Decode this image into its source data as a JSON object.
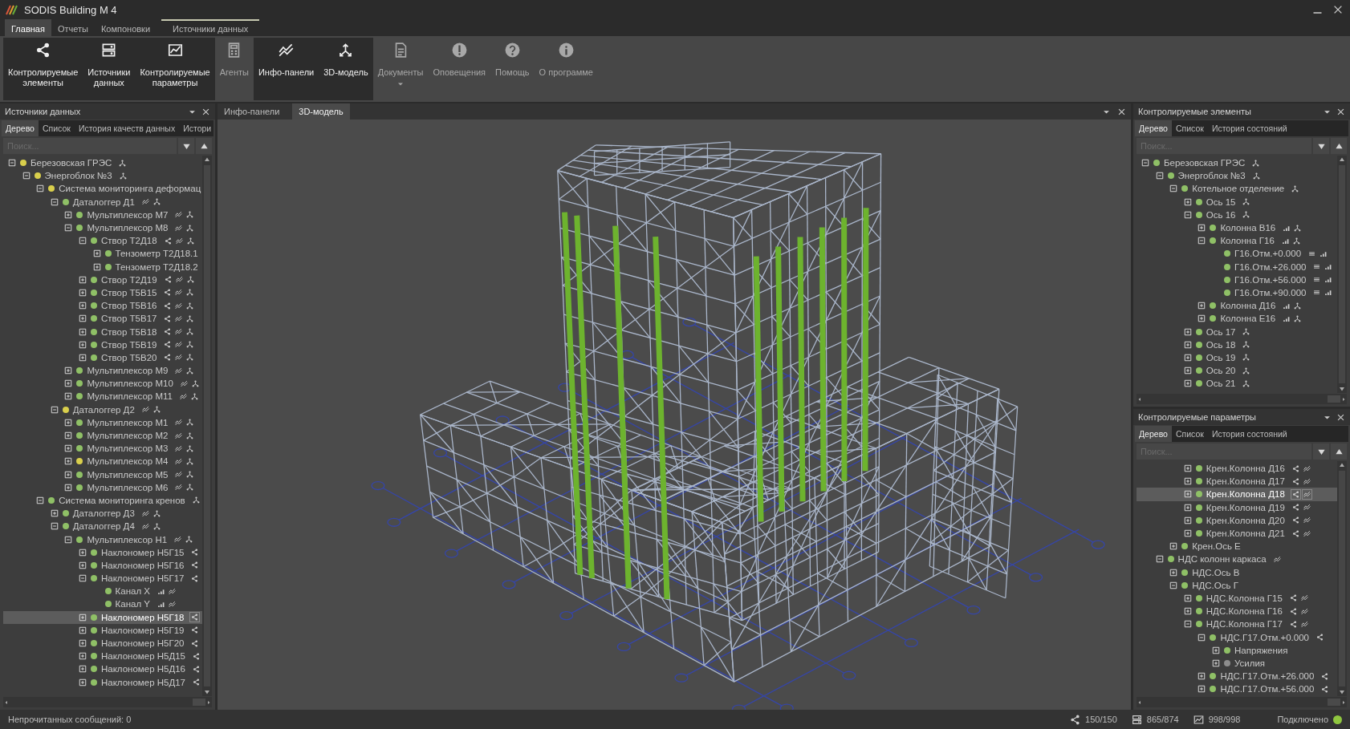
{
  "window": {
    "title": "SODIS Building M 4"
  },
  "ribbon_tabs": [
    {
      "label": "Главная",
      "selected": true,
      "contextual": false
    },
    {
      "label": "Отчеты",
      "selected": false,
      "contextual": false
    },
    {
      "label": "Компоновки",
      "selected": false,
      "contextual": false
    },
    {
      "label": "Источники данных",
      "selected": false,
      "contextual": true
    }
  ],
  "ribbon_buttons": [
    {
      "kind": "share",
      "label": "Контролируемые\nэлементы",
      "selected": true
    },
    {
      "kind": "sources",
      "label": "Источники\nданных",
      "selected": true
    },
    {
      "kind": "chart",
      "label": "Контролируемые\nпараметры",
      "selected": true
    },
    {
      "kind": "calculator",
      "label": "Агенты",
      "selected": false
    },
    {
      "kind": "trend",
      "label": "Инфо-панели",
      "selected": true
    },
    {
      "kind": "model",
      "label": "3D-модель",
      "selected": true
    },
    {
      "kind": "document",
      "label": "Документы",
      "selected": false,
      "dropdown": true
    },
    {
      "kind": "alert",
      "label": "Оповещения",
      "selected": false
    },
    {
      "kind": "help",
      "label": "Помощь",
      "selected": false
    },
    {
      "kind": "info",
      "label": "О программе",
      "selected": false
    }
  ],
  "left_panel": {
    "title": "Источники данных",
    "tabs": [
      {
        "label": "Дерево",
        "selected": true
      },
      {
        "label": "Список",
        "selected": false
      },
      {
        "label": "История качеств данных",
        "selected": false
      },
      {
        "label": "Истори",
        "selected": false
      }
    ],
    "search": {
      "placeholder": "Поиск..."
    },
    "tree": [
      {
        "label": "Березовская ГРЭС",
        "color": "#d9cf4c",
        "expanded": true,
        "selected": false,
        "hierarchy": true,
        "children": [
          {
            "label": "Энергоблок №3",
            "color": "#d9cf4c",
            "expanded": true,
            "selected": false,
            "hierarchy": true,
            "children": [
              {
                "label": "Система мониторинга деформац",
                "color": "#d9cf4c",
                "expanded": true,
                "selected": false,
                "children": [
                  {
                    "label": "Даталоггер Д1",
                    "color": "#8fc066",
                    "expanded": true,
                    "selected": false,
                    "trend": true,
                    "hierarchy": true,
                    "children": [
                      {
                        "label": "Мультиплексор М7",
                        "color": "#8fc066",
                        "expanded": false,
                        "selected": false,
                        "trend": true,
                        "hierarchy": true
                      },
                      {
                        "label": "Мультиплексор М8",
                        "color": "#8fc066",
                        "expanded": true,
                        "selected": false,
                        "trend": true,
                        "hierarchy": true,
                        "children": [
                          {
                            "label": "Створ Т2Д18",
                            "color": "#8fc066",
                            "expanded": true,
                            "selected": false,
                            "share": true,
                            "trend": true,
                            "hierarchy": true,
                            "children": [
                              {
                                "label": "Тензометр Т2Д18.1",
                                "color": "#8fc066",
                                "expanded": false,
                                "selected": false
                              },
                              {
                                "label": "Тензометр Т2Д18.2",
                                "color": "#8fc066",
                                "expanded": false,
                                "selected": false
                              }
                            ]
                          },
                          {
                            "label": "Створ Т2Д19",
                            "color": "#8fc066",
                            "expanded": false,
                            "selected": false,
                            "share": true,
                            "trend": true,
                            "hierarchy": true
                          },
                          {
                            "label": "Створ Т5В15",
                            "color": "#8fc066",
                            "expanded": false,
                            "selected": false,
                            "share": true,
                            "trend": true,
                            "hierarchy": true
                          },
                          {
                            "label": "Створ Т5В16",
                            "color": "#8fc066",
                            "expanded": false,
                            "selected": false,
                            "share": true,
                            "trend": true,
                            "hierarchy": true
                          },
                          {
                            "label": "Створ Т5В17",
                            "color": "#8fc066",
                            "expanded": false,
                            "selected": false,
                            "share": true,
                            "trend": true,
                            "hierarchy": true
                          },
                          {
                            "label": "Створ Т5В18",
                            "color": "#8fc066",
                            "expanded": false,
                            "selected": false,
                            "share": true,
                            "trend": true,
                            "hierarchy": true
                          },
                          {
                            "label": "Створ Т5В19",
                            "color": "#8fc066",
                            "expanded": false,
                            "selected": false,
                            "share": true,
                            "trend": true,
                            "hierarchy": true
                          },
                          {
                            "label": "Створ Т5В20",
                            "color": "#8fc066",
                            "expanded": false,
                            "selected": false,
                            "share": true,
                            "trend": true,
                            "hierarchy": true
                          }
                        ]
                      },
                      {
                        "label": "Мультиплексор М9",
                        "color": "#8fc066",
                        "expanded": false,
                        "selected": false,
                        "trend": true,
                        "hierarchy": true
                      },
                      {
                        "label": "Мультиплексор М10",
                        "color": "#8fc066",
                        "expanded": false,
                        "selected": false,
                        "trend": true,
                        "hierarchy": true
                      },
                      {
                        "label": "Мультиплексор М11",
                        "color": "#8fc066",
                        "expanded": false,
                        "selected": false,
                        "trend": true,
                        "hierarchy": true
                      }
                    ]
                  },
                  {
                    "label": "Даталоггер Д2",
                    "color": "#d9cf4c",
                    "expanded": true,
                    "selected": false,
                    "trend": true,
                    "hierarchy": true,
                    "children": [
                      {
                        "label": "Мультиплексор М1",
                        "color": "#8fc066",
                        "expanded": false,
                        "selected": false,
                        "trend": true,
                        "hierarchy": true
                      },
                      {
                        "label": "Мультиплексор М2",
                        "color": "#8fc066",
                        "expanded": false,
                        "selected": false,
                        "trend": true,
                        "hierarchy": true
                      },
                      {
                        "label": "Мультиплексор М3",
                        "color": "#8fc066",
                        "expanded": false,
                        "selected": false,
                        "trend": true,
                        "hierarchy": true
                      },
                      {
                        "label": "Мультиплексор М4",
                        "color": "#d9cf4c",
                        "expanded": false,
                        "selected": false,
                        "trend": true,
                        "hierarchy": true
                      },
                      {
                        "label": "Мультиплексор М5",
                        "color": "#8fc066",
                        "expanded": false,
                        "selected": false,
                        "trend": true,
                        "hierarchy": true
                      },
                      {
                        "label": "Мультиплексор М6",
                        "color": "#8fc066",
                        "expanded": false,
                        "selected": false,
                        "trend": true,
                        "hierarchy": true
                      }
                    ]
                  }
                ]
              },
              {
                "label": "Система мониторинга кренов",
                "color": "#8fc066",
                "expanded": true,
                "selected": false,
                "hierarchy": true,
                "children": [
                  {
                    "label": "Даталоггер Д3",
                    "color": "#8fc066",
                    "expanded": false,
                    "selected": false,
                    "trend": true,
                    "hierarchy": true
                  },
                  {
                    "label": "Даталоггер Д4",
                    "color": "#8fc066",
                    "expanded": true,
                    "selected": false,
                    "trend": true,
                    "hierarchy": true,
                    "children": [
                      {
                        "label": "Мультиплексор Н1",
                        "color": "#8fc066",
                        "expanded": true,
                        "selected": false,
                        "trend": true,
                        "hierarchy": true,
                        "children": [
                          {
                            "label": "Наклономер Н5Г15",
                            "color": "#8fc066",
                            "expanded": false,
                            "selected": false,
                            "share": true
                          },
                          {
                            "label": "Наклономер Н5Г16",
                            "color": "#8fc066",
                            "expanded": false,
                            "selected": false,
                            "share": true
                          },
                          {
                            "label": "Наклономер Н5Г17",
                            "color": "#8fc066",
                            "expanded": true,
                            "selected": false,
                            "share": true,
                            "children": [
                              {
                                "label": "Канал X",
                                "color": "#8fc066",
                                "selected": false,
                                "signal": true,
                                "trend": true
                              },
                              {
                                "label": "Канал Y",
                                "color": "#8fc066",
                                "selected": false,
                                "signal": true,
                                "trend": true
                              }
                            ]
                          },
                          {
                            "label": "Наклономер Н5Г18",
                            "color": "#8fc066",
                            "expanded": false,
                            "selected": true,
                            "share": true
                          },
                          {
                            "label": "Наклономер Н5Г19",
                            "color": "#8fc066",
                            "expanded": false,
                            "selected": false,
                            "share": true
                          },
                          {
                            "label": "Наклономер Н5Г20",
                            "color": "#8fc066",
                            "expanded": false,
                            "selected": false,
                            "share": true
                          },
                          {
                            "label": "Наклономер Н5Д15",
                            "color": "#8fc066",
                            "expanded": false,
                            "selected": false,
                            "share": true
                          },
                          {
                            "label": "Наклономер Н5Д16",
                            "color": "#8fc066",
                            "expanded": false,
                            "selected": false,
                            "share": true
                          },
                          {
                            "label": "Наклономер Н5Д17",
                            "color": "#8fc066",
                            "expanded": false,
                            "selected": false,
                            "share": true
                          }
                        ]
                      }
                    ]
                  }
                ]
              }
            ]
          }
        ]
      }
    ]
  },
  "document_tabs": [
    {
      "label": "Инфо-панели",
      "selected": false
    },
    {
      "label": "3D-модель",
      "selected": true
    }
  ],
  "right_top_panel": {
    "title": "Контролируемые элементы",
    "tabs": [
      {
        "label": "Дерево",
        "selected": true
      },
      {
        "label": "Список",
        "selected": false
      },
      {
        "label": "История состояний",
        "selected": false
      }
    ],
    "search": {
      "placeholder": "Поиск..."
    },
    "tree": [
      {
        "label": "Березовская ГРЭС",
        "color": "#8fc066",
        "expanded": true,
        "selected": false,
        "hierarchy": true,
        "children": [
          {
            "label": "Энергоблок №3",
            "color": "#8fc066",
            "expanded": true,
            "selected": false,
            "hierarchy": true,
            "children": [
              {
                "label": "Котельное отделение",
                "color": "#8fc066",
                "expanded": true,
                "selected": false,
                "hierarchy": true,
                "children": [
                  {
                    "label": "Ось 15",
                    "color": "#8fc066",
                    "expanded": false,
                    "selected": false,
                    "hierarchy": true
                  },
                  {
                    "label": "Ось 16",
                    "color": "#8fc066",
                    "expanded": true,
                    "selected": false,
                    "hierarchy": true,
                    "children": [
                      {
                        "label": "Колонна В16",
                        "color": "#8fc066",
                        "expanded": false,
                        "selected": false,
                        "signal": true,
                        "hierarchy": true
                      },
                      {
                        "label": "Колонна Г16",
                        "color": "#8fc066",
                        "expanded": true,
                        "selected": false,
                        "signal": true,
                        "hierarchy": true,
                        "children": [
                          {
                            "label": "Г16.Отм.+0.000",
                            "color": "#8fc066",
                            "selected": false,
                            "list": true,
                            "signal": true
                          },
                          {
                            "label": "Г16.Отм.+26.000",
                            "color": "#8fc066",
                            "selected": false,
                            "list": true,
                            "signal": true
                          },
                          {
                            "label": "Г16.Отм.+56.000",
                            "color": "#8fc066",
                            "selected": false,
                            "list": true,
                            "signal": true
                          },
                          {
                            "label": "Г16.Отм.+90.000",
                            "color": "#8fc066",
                            "selected": false,
                            "list": true,
                            "signal": true
                          }
                        ]
                      },
                      {
                        "label": "Колонна Д16",
                        "color": "#8fc066",
                        "expanded": false,
                        "selected": false,
                        "signal": true,
                        "hierarchy": true
                      },
                      {
                        "label": "Колонна Е16",
                        "color": "#8fc066",
                        "expanded": false,
                        "selected": false,
                        "signal": true,
                        "hierarchy": true
                      }
                    ]
                  },
                  {
                    "label": "Ось 17",
                    "color": "#8fc066",
                    "expanded": false,
                    "selected": false,
                    "hierarchy": true
                  },
                  {
                    "label": "Ось 18",
                    "color": "#8fc066",
                    "expanded": false,
                    "selected": false,
                    "hierarchy": true
                  },
                  {
                    "label": "Ось 19",
                    "color": "#8fc066",
                    "expanded": false,
                    "selected": false,
                    "hierarchy": true
                  },
                  {
                    "label": "Ось 20",
                    "color": "#8fc066",
                    "expanded": false,
                    "selected": false,
                    "hierarchy": true
                  },
                  {
                    "label": "Ось 21",
                    "color": "#8fc066",
                    "expanded": false,
                    "selected": false,
                    "hierarchy": true
                  }
                ]
              }
            ]
          }
        ]
      }
    ]
  },
  "right_bottom_panel": {
    "title": "Контролируемые параметры",
    "tabs": [
      {
        "label": "Дерево",
        "selected": true
      },
      {
        "label": "Список",
        "selected": false
      },
      {
        "label": "История состояний",
        "selected": false
      }
    ],
    "search": {
      "placeholder": "Поиск..."
    },
    "tree": [
      {
        "children": [
          {
            "children": [
              {
                "children": [
                  {
                    "label": "Крен.Колонна Д16",
                    "color": "#8fc066",
                    "expanded": false,
                    "selected": false,
                    "share": true,
                    "trend": true
                  },
                  {
                    "label": "Крен.Колонна Д17",
                    "color": "#8fc066",
                    "expanded": false,
                    "selected": false,
                    "share": true,
                    "trend": true
                  },
                  {
                    "label": "Крен.Колонна Д18",
                    "color": "#8fc066",
                    "expanded": false,
                    "selected": true,
                    "share": true,
                    "trend": true
                  },
                  {
                    "label": "Крен.Колонна Д19",
                    "color": "#8fc066",
                    "expanded": false,
                    "selected": false,
                    "share": true,
                    "trend": true
                  },
                  {
                    "label": "Крен.Колонна Д20",
                    "color": "#8fc066",
                    "expanded": false,
                    "selected": false,
                    "share": true,
                    "trend": true
                  },
                  {
                    "label": "Крен.Колонна Д21",
                    "color": "#8fc066",
                    "expanded": false,
                    "selected": false,
                    "share": true,
                    "trend": true
                  }
                ]
              },
              {
                "label": "Крен.Ось Е",
                "color": "#8fc066",
                "expanded": false,
                "selected": false
              }
            ]
          },
          {
            "label": "НДС колонн каркаса",
            "color": "#8fc066",
            "expanded": true,
            "selected": false,
            "trend": true,
            "children": [
              {
                "label": "НДС.Ось В",
                "color": "#8fc066",
                "expanded": false,
                "selected": false
              },
              {
                "label": "НДС.Ось Г",
                "color": "#8fc066",
                "expanded": true,
                "selected": false,
                "children": [
                  {
                    "label": "НДС.Колонна Г15",
                    "color": "#8fc066",
                    "expanded": false,
                    "selected": false,
                    "share": true,
                    "trend": true
                  },
                  {
                    "label": "НДС.Колонна Г16",
                    "color": "#8fc066",
                    "expanded": false,
                    "selected": false,
                    "share": true,
                    "trend": true
                  },
                  {
                    "label": "НДС.Колонна Г17",
                    "color": "#8fc066",
                    "expanded": true,
                    "selected": false,
                    "share": true,
                    "trend": true,
                    "children": [
                      {
                        "label": "НДС.Г17.Отм.+0.000",
                        "color": "#8fc066",
                        "expanded": true,
                        "selected": false,
                        "share": true,
                        "children": [
                          {
                            "label": "Напряжения",
                            "color": "#8fc066",
                            "expanded": false,
                            "selected": false
                          },
                          {
                            "label": "Усилия",
                            "color": "#8c8c8c",
                            "expanded": false,
                            "selected": false
                          }
                        ]
                      },
                      {
                        "label": "НДС.Г17.Отм.+26.000",
                        "color": "#8fc066",
                        "expanded": false,
                        "selected": false,
                        "share": true
                      },
                      {
                        "label": "НДС.Г17.Отм.+56.000",
                        "color": "#8fc066",
                        "expanded": false,
                        "selected": false,
                        "share": true
                      }
                    ]
                  }
                ]
              }
            ]
          }
        ]
      }
    ]
  },
  "status_bar": {
    "messages": "Непрочитанных сообщений: 0",
    "counters": [
      {
        "kind": "share",
        "text": "150/150"
      },
      {
        "kind": "sources",
        "text": "865/874"
      },
      {
        "kind": "chart",
        "text": "998/998"
      }
    ],
    "connection": {
      "label": "Подключено",
      "color": "#8fc63f"
    }
  }
}
